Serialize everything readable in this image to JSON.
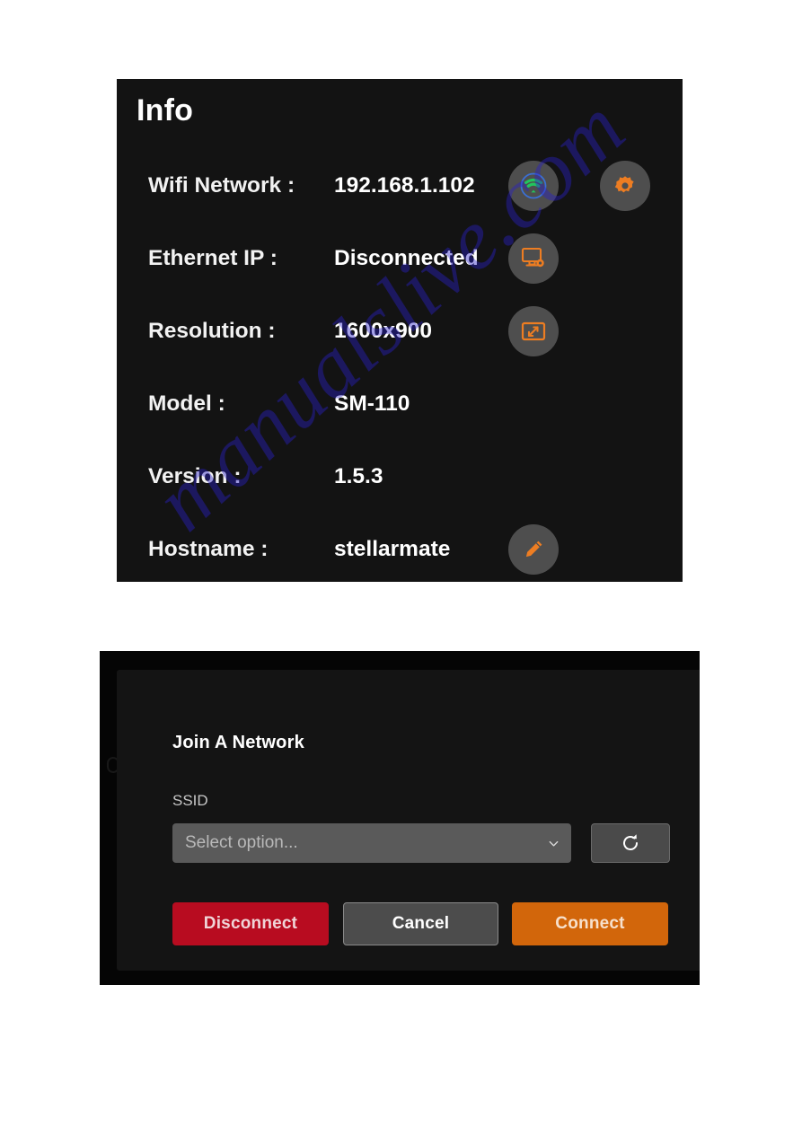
{
  "info_panel": {
    "title": "Info",
    "rows": [
      {
        "label": "Wifi Network :",
        "value": "192.168.1.102",
        "primary_icon": "wifi-connected-icon",
        "secondary_icon": "gear-icon"
      },
      {
        "label": "Ethernet IP :",
        "value": "Disconnected",
        "primary_icon": "monitor-icon",
        "secondary_icon": null
      },
      {
        "label": "Resolution :",
        "value": "1600x900",
        "primary_icon": "resize-image-icon",
        "secondary_icon": null
      },
      {
        "label": "Model :",
        "value": "SM-110",
        "primary_icon": null,
        "secondary_icon": null
      },
      {
        "label": "Version :",
        "value": "1.5.3",
        "primary_icon": null,
        "secondary_icon": null
      },
      {
        "label": "Hostname :",
        "value": "stellarmate",
        "primary_icon": "pencil-edit-icon",
        "secondary_icon": null
      }
    ]
  },
  "network_dialog": {
    "heading": "Join A Network",
    "ssid_label": "SSID",
    "ssid_placeholder": "Select option...",
    "ssid_value": "",
    "refresh_icon": "refresh-icon",
    "chevron_icon": "chevron-down-icon",
    "buttons": {
      "disconnect": "Disconnect",
      "cancel": "Cancel",
      "connect": "Connect"
    }
  },
  "watermark": {
    "text": "manualslive.com"
  },
  "colors": {
    "panel_background": "#131313",
    "dialog_background": "#141414",
    "icon_orange": "#ED7D22",
    "icon_green": "#22C55E",
    "icon_ring_blue": "#3B6FD4",
    "disconnect_red": "#B80C20",
    "connect_orange": "#D2660B",
    "cancel_gray": "#4C4C4C",
    "select_gray": "#5A5A5A"
  }
}
